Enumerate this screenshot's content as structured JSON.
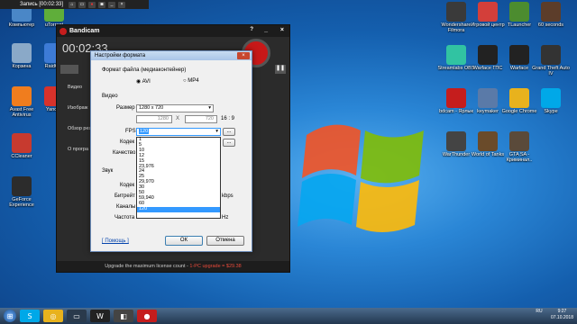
{
  "recording_bar": {
    "title": "Запись [00:02:33]"
  },
  "desktop_left": [
    {
      "label": "Компьютер",
      "icon": "computer-icon",
      "color": "#4a87c7"
    },
    {
      "label": "uTorrent",
      "icon": "utorrent-icon",
      "color": "#5fae3a"
    },
    {
      "label": "Корзина",
      "icon": "recycle-bin-icon",
      "color": "#8aa9c8"
    },
    {
      "label": "RaidCall",
      "icon": "raidcall-icon",
      "color": "#3d7bd6"
    },
    {
      "label": "Avast Free Antivirus",
      "icon": "avast-icon",
      "color": "#f07d1e"
    },
    {
      "label": "Yandex",
      "icon": "yandex-icon",
      "color": "#d8322b"
    },
    {
      "label": "CCleaner",
      "icon": "ccleaner-icon",
      "color": "#c73a2f"
    },
    {
      "label": "GeForce Experience",
      "icon": "geforce-icon",
      "color": "#2c2c2c"
    }
  ],
  "desktop_right": [
    {
      "label": "Wondershare Filmora",
      "icon": "filmora-icon",
      "color": "#3a3a3a"
    },
    {
      "label": "Игровой центр",
      "icon": "game-center-icon",
      "color": "#d33f3a"
    },
    {
      "label": "TLauncher",
      "icon": "tlauncher-icon",
      "color": "#4c8c2f"
    },
    {
      "label": "60 seconds",
      "icon": "sixty-seconds-icon",
      "color": "#5c3d2a"
    },
    {
      "label": "Streamlabs OBS",
      "icon": "streamlabs-icon",
      "color": "#31c3a2"
    },
    {
      "label": "Warface ГПС",
      "icon": "warface-icon",
      "color": "#222"
    },
    {
      "label": "Warface",
      "icon": "warface-icon",
      "color": "#222"
    },
    {
      "label": "Grand Theft Auto IV",
      "icon": "gta4-icon",
      "color": "#333"
    },
    {
      "label": "bdcam - Ярлык",
      "icon": "bandicam-icon",
      "color": "#c51d1d"
    },
    {
      "label": "keymaker",
      "icon": "keymaker-icon",
      "color": "#5a7aa8"
    },
    {
      "label": "Google Chrome",
      "icon": "chrome-icon",
      "color": "#e8b21d"
    },
    {
      "label": "Skype",
      "icon": "skype-icon",
      "color": "#00a8e8"
    },
    {
      "label": "WarThunder",
      "icon": "warthunder-icon",
      "color": "#444"
    },
    {
      "label": "World of Tanks",
      "icon": "wot-icon",
      "color": "#6a4b2a"
    },
    {
      "label": "GTA SA - Криминал..",
      "icon": "gtasa-icon",
      "color": "#5a4a3a"
    }
  ],
  "bandicam": {
    "title": "Bandicam",
    "time": "00:02:33",
    "side": [
      "Видео",
      "Изображ",
      "Обзор резу",
      "О програ"
    ],
    "upgrade_text": "Upgrade the maximum license count - ",
    "upgrade_link": "1-PC upgrade = $29.38"
  },
  "dialog": {
    "title": "Настройки формата",
    "format_label": "Формат файла (медиаконтейнер)",
    "avi": "AVI",
    "mp4": "MP4",
    "video_group": "Видео",
    "size_label": "Размер",
    "size_value": "1280 x 720",
    "width": "1280",
    "x": "X",
    "height": "720",
    "ratio": "16 : 9",
    "fps_label": "FPS",
    "fps_value": "120",
    "codec_label": "Кодек",
    "quality_label": "Качество",
    "audio_group": "Звук",
    "audio_codec_label": "Кодек",
    "bitrate_label": "Битрейт",
    "channels_label": "Каналы",
    "frequency_label": "Частота",
    "kbps": "kbps",
    "hz": "Hz",
    "help": "[ Помощь ]",
    "ok": "ОК",
    "cancel": "Отмена",
    "more": "...",
    "fps_options": [
      "1",
      "5",
      "10",
      "12",
      "15",
      "23,976",
      "24",
      "25",
      "29,970",
      "30",
      "50",
      "59,940",
      "60",
      "120"
    ],
    "fps_selected": "120"
  },
  "taskbar": {
    "lang": "RU",
    "time": "9:27",
    "date": "07.10.2018"
  }
}
